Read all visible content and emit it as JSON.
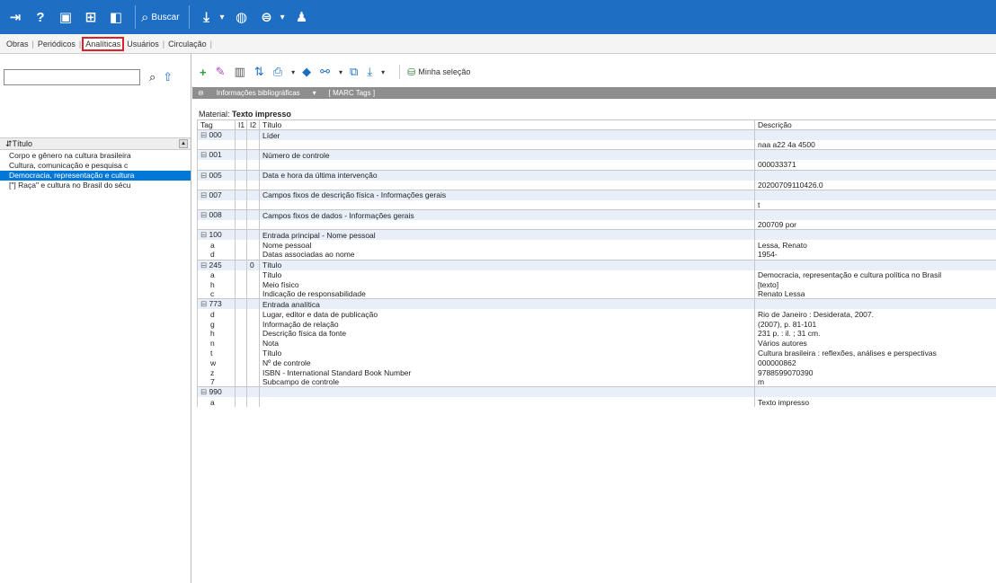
{
  "topbar": {
    "icons": [
      "exit-icon",
      "help-icon",
      "save-icon",
      "report-icon",
      "record-icon"
    ],
    "search_label": "Buscar",
    "tools": [
      "export-icon",
      "globe-icon",
      "globe2-icon",
      "users-icon"
    ]
  },
  "tabs": [
    {
      "label": "Obras",
      "active": false
    },
    {
      "label": "Periódicos",
      "active": false
    },
    {
      "label": "Analíticas",
      "active": true
    },
    {
      "label": "Usuários",
      "active": false
    },
    {
      "label": "Circulação",
      "active": false
    }
  ],
  "left": {
    "search_value": "",
    "column_header": "Título",
    "items": [
      {
        "label": "Corpo e gênero na cultura brasileira",
        "selected": false
      },
      {
        "label": "Cultura, comunicação e pesquisa c",
        "selected": false
      },
      {
        "label": "Democracia, representação e cultura",
        "selected": true
      },
      {
        "label": "[\"] Raça\" e cultura no Brasil do sécu",
        "selected": false
      }
    ]
  },
  "right_toolbar": {
    "selection_label": "Minha seleção"
  },
  "graybar": {
    "left": "Informações bibliográficas",
    "right": "[ MARC Tags ]"
  },
  "material": {
    "label": "Material:",
    "value": "Texto impresso"
  },
  "table": {
    "headers": [
      "Tag",
      "I1",
      "I2",
      "Título",
      "Descrição"
    ],
    "rows": [
      {
        "kind": "tag",
        "tag": "000",
        "i1": "",
        "i2": "",
        "title": "Líder",
        "desc": ""
      },
      {
        "kind": "sub",
        "tag": "",
        "i1": "",
        "i2": "",
        "title": "",
        "desc": "naa a22   4a 4500"
      },
      {
        "kind": "tag",
        "tag": "001",
        "i1": "",
        "i2": "",
        "title": "Número de controle",
        "desc": ""
      },
      {
        "kind": "sub",
        "tag": "",
        "i1": "",
        "i2": "",
        "title": "",
        "desc": "000033371"
      },
      {
        "kind": "tag",
        "tag": "005",
        "i1": "",
        "i2": "",
        "title": "Data e hora da última intervenção",
        "desc": ""
      },
      {
        "kind": "sub",
        "tag": "",
        "i1": "",
        "i2": "",
        "title": "",
        "desc": "20200709110426.0"
      },
      {
        "kind": "tag",
        "tag": "007",
        "i1": "",
        "i2": "",
        "title": "Campos fixos de descrição física - Informações gerais",
        "desc": ""
      },
      {
        "kind": "sub",
        "tag": "",
        "i1": "",
        "i2": "",
        "title": "",
        "desc": "t"
      },
      {
        "kind": "tag",
        "tag": "008",
        "i1": "",
        "i2": "",
        "title": "Campos fixos de dados - Informações gerais",
        "desc": ""
      },
      {
        "kind": "sub",
        "tag": "",
        "i1": "",
        "i2": "",
        "title": "",
        "desc": "200709                      por"
      },
      {
        "kind": "tag",
        "tag": "100",
        "i1": "",
        "i2": "",
        "title": "Entrada principal - Nome pessoal",
        "desc": ""
      },
      {
        "kind": "sub",
        "tag": "a",
        "i1": "",
        "i2": "",
        "title": "Nome pessoal",
        "desc": "Lessa, Renato"
      },
      {
        "kind": "sub",
        "tag": "d",
        "i1": "",
        "i2": "",
        "title": "Datas associadas ao nome",
        "desc": "1954-"
      },
      {
        "kind": "tag",
        "tag": "245",
        "i1": "",
        "i2": "0",
        "title": "Título",
        "desc": ""
      },
      {
        "kind": "sub",
        "tag": "a",
        "i1": "",
        "i2": "",
        "title": "Título",
        "desc": "Democracia, representação e cultura política no Brasil"
      },
      {
        "kind": "sub",
        "tag": "h",
        "i1": "",
        "i2": "",
        "title": "Meio físico",
        "desc": "[texto]"
      },
      {
        "kind": "sub",
        "tag": "c",
        "i1": "",
        "i2": "",
        "title": "Indicação de responsabilidade",
        "desc": "Renato Lessa"
      },
      {
        "kind": "tag",
        "tag": "773",
        "i1": "",
        "i2": "",
        "title": "Entrada analítica",
        "desc": ""
      },
      {
        "kind": "sub",
        "tag": "d",
        "i1": "",
        "i2": "",
        "title": "Lugar, editor e data de publicação",
        "desc": "Rio de Janeiro : Desiderata, 2007."
      },
      {
        "kind": "sub",
        "tag": "g",
        "i1": "",
        "i2": "",
        "title": "Informação de relação",
        "desc": "(2007), p. 81-101"
      },
      {
        "kind": "sub",
        "tag": "h",
        "i1": "",
        "i2": "",
        "title": "Descrição física da fonte",
        "desc": "231 p. : il. ; 31 cm."
      },
      {
        "kind": "sub",
        "tag": "n",
        "i1": "",
        "i2": "",
        "title": "Nota",
        "desc": "Vários autores"
      },
      {
        "kind": "sub",
        "tag": "t",
        "i1": "",
        "i2": "",
        "title": "Título",
        "desc": "Cultura brasileira : reflexões, análises e perspectivas"
      },
      {
        "kind": "sub",
        "tag": "w",
        "i1": "",
        "i2": "",
        "title": "Nº de controle",
        "desc": "000000862"
      },
      {
        "kind": "sub",
        "tag": "z",
        "i1": "",
        "i2": "",
        "title": "ISBN - International Standard Book Number",
        "desc": "9788599070390"
      },
      {
        "kind": "sub",
        "tag": "7",
        "i1": "",
        "i2": "",
        "title": "Subcampo de controle",
        "desc": "m"
      },
      {
        "kind": "tag",
        "tag": "990",
        "i1": "",
        "i2": "",
        "title": "",
        "desc": ""
      },
      {
        "kind": "sub",
        "tag": "a",
        "i1": "",
        "i2": "",
        "title": "",
        "desc": "Texto impresso"
      }
    ]
  }
}
